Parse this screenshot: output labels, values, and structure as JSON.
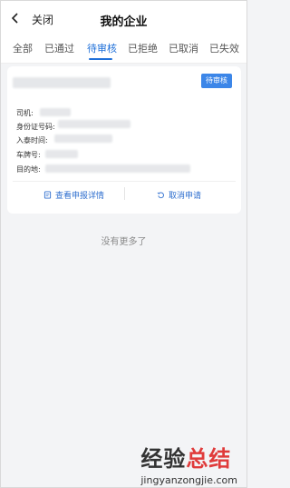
{
  "header": {
    "close_label": "关闭",
    "title": "我的企业"
  },
  "tabs": [
    {
      "label": "全部"
    },
    {
      "label": "已通过"
    },
    {
      "label": "待审核"
    },
    {
      "label": "已拒绝"
    },
    {
      "label": "已取消"
    },
    {
      "label": "已失效"
    }
  ],
  "active_tab": "待审核",
  "card": {
    "status_label": "待审核",
    "fields": [
      {
        "label": "司机:"
      },
      {
        "label": "身份证号码:"
      },
      {
        "label": "入泰时间:"
      },
      {
        "label": "车牌号:"
      },
      {
        "label": "目的地:"
      }
    ],
    "actions": {
      "details_label": "查看申报详情",
      "cancel_label": "取消申请"
    }
  },
  "footer_text": "没有更多了",
  "watermark": {
    "text_black": "经验",
    "text_red": "总结",
    "url": "jingyanzongjie.com"
  },
  "colors": {
    "accent": "#1e6fd9",
    "status_bg": "#3c86e8",
    "watermark_red": "#e03b3b"
  }
}
